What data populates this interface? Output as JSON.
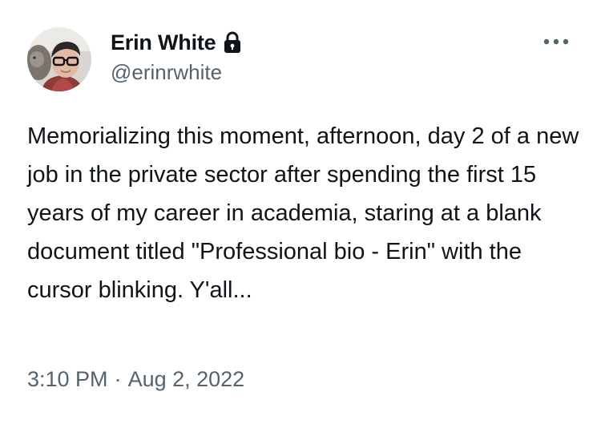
{
  "author": {
    "display_name": "Erin White",
    "handle": "@erinrwhite",
    "protected_icon": "lock-icon",
    "avatar_icon": "avatar-photo"
  },
  "tweet": {
    "text": "Memorializing this moment, afternoon, day 2 of a new job in the private sector after spending the first 15 years of my career in academia, staring at a blank document titled \"Professional bio - Erin\" with the cursor blinking. Y'all...",
    "time": "3:10 PM",
    "separator": "·",
    "date": "Aug 2, 2022"
  },
  "actions": {
    "more_icon": "more-horizontal-icon"
  },
  "colors": {
    "text_primary": "#0f1419",
    "text_secondary": "#536471",
    "background": "#ffffff"
  }
}
